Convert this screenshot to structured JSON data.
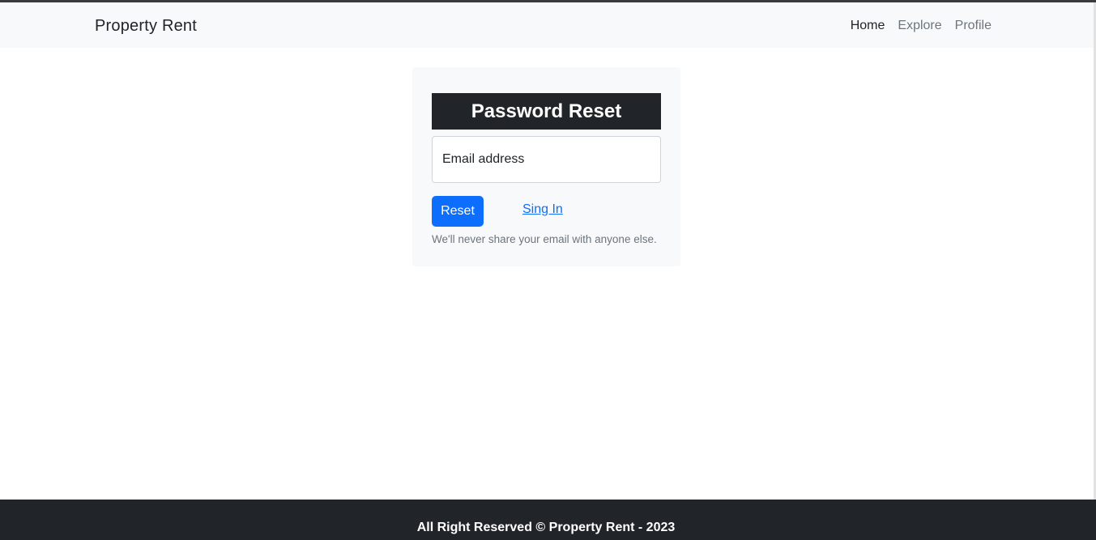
{
  "navbar": {
    "brand": "Property Rent",
    "links": [
      {
        "label": "Home",
        "active": true
      },
      {
        "label": "Explore",
        "active": false
      },
      {
        "label": "Profile",
        "active": false
      }
    ]
  },
  "form": {
    "title": "Password Reset",
    "email_placeholder": "Email address",
    "email_value": "",
    "reset_label": "Reset",
    "signin_label": "Sing In",
    "help_text": "We'll never share your email with anyone else."
  },
  "footer": {
    "text": "All Right Reserved © Property Rent - 2023"
  },
  "colors": {
    "navbar_bg": "#f8f9fa",
    "title_bg": "#212529",
    "primary": "#0d6efd",
    "footer_bg": "#212529",
    "muted": "#6c757d"
  }
}
